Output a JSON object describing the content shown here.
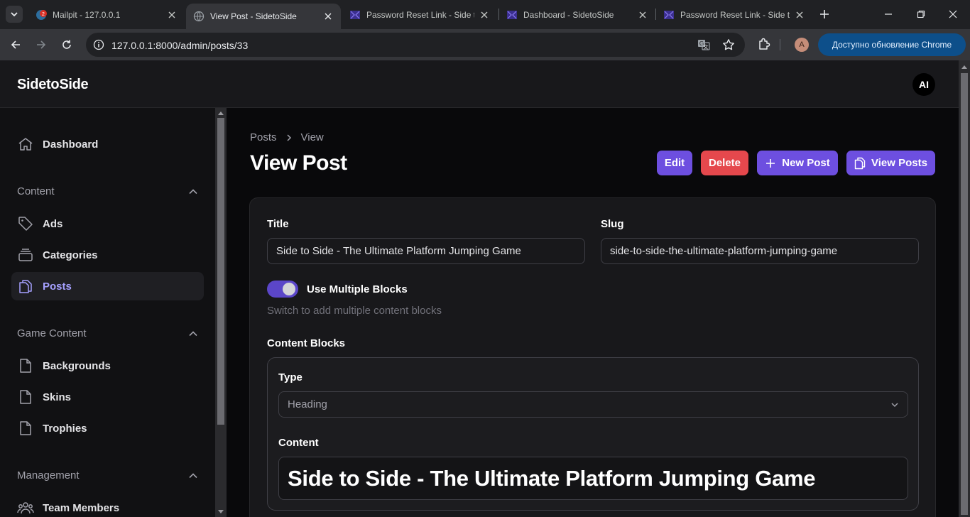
{
  "browser": {
    "tabs": [
      {
        "title": "Mailpit - 127.0.0.1",
        "badge": "2",
        "active": false
      },
      {
        "title": "View Post - SidetoSide",
        "active": true
      },
      {
        "title": "Password Reset Link - Side to",
        "active": false
      },
      {
        "title": "Dashboard - SidetoSide",
        "active": false
      },
      {
        "title": "Password Reset Link - Side to",
        "active": false
      }
    ],
    "url": "127.0.0.1:8000/admin/posts/33",
    "profile_initial": "A",
    "update_label": "Доступно обновление Chrome"
  },
  "app": {
    "brand": "SidetoSide",
    "user_initials": "AI"
  },
  "sidebar": {
    "dashboard": "Dashboard",
    "groups": [
      {
        "label": "Content",
        "items": [
          "Ads",
          "Categories",
          "Posts"
        ]
      },
      {
        "label": "Game Content",
        "items": [
          "Backgrounds",
          "Skins",
          "Trophies"
        ]
      },
      {
        "label": "Management",
        "items": [
          "Team Members"
        ]
      }
    ],
    "active_item": "Posts"
  },
  "main": {
    "breadcrumb": [
      "Posts",
      "View"
    ],
    "title": "View Post",
    "actions": {
      "edit": "Edit",
      "delete": "Delete",
      "new_post": "New Post",
      "view_posts": "View Posts"
    },
    "form": {
      "title_label": "Title",
      "title_value": "Side to Side - The Ultimate Platform Jumping Game",
      "slug_label": "Slug",
      "slug_value": "side-to-side-the-ultimate-platform-jumping-game",
      "toggle_label": "Use Multiple Blocks",
      "toggle_on": true,
      "toggle_helper": "Switch to add multiple content blocks",
      "blocks_label": "Content Blocks",
      "type_label": "Type",
      "type_value": "Heading",
      "content_label": "Content",
      "content_value": "Side to Side - The Ultimate Platform Jumping Game"
    }
  },
  "colors": {
    "accent": "#6d4fe0",
    "danger": "#e5484d",
    "active_nav_text": "#a5a0ff"
  }
}
